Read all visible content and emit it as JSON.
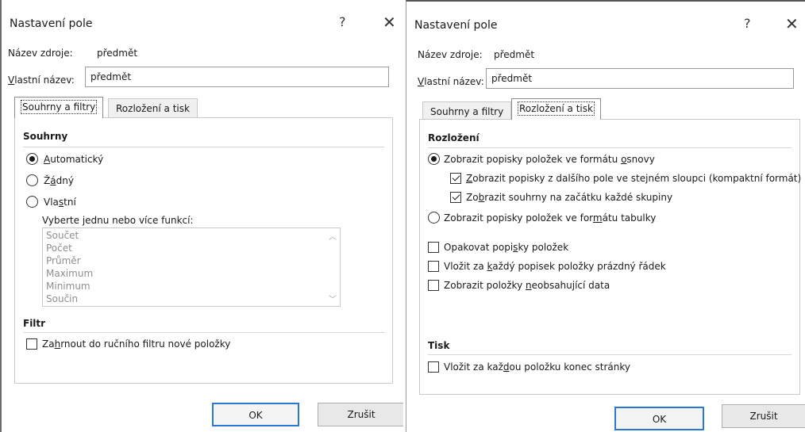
{
  "left_dialog": {
    "title": "Nastavení pole",
    "help": "?",
    "close": "✕",
    "source_name_label": "Název zdroje:",
    "source_name_value": "předmět",
    "custom_name_label": "Vlastní název:",
    "custom_name_value": "předmět",
    "tabs": [
      {
        "label": "Souhrny a filtry",
        "active": true
      },
      {
        "label": "Rozložení a tisk",
        "active": false
      }
    ],
    "summaries": {
      "heading": "Souhrny",
      "options": [
        {
          "label": "Automatický",
          "selected": true
        },
        {
          "label": "Žádný",
          "selected": false
        },
        {
          "label": "Vlastní",
          "selected": false
        }
      ],
      "functions_label": "Vyberte jednu nebo více funkcí:",
      "functions": [
        "Součet",
        "Počet",
        "Průměr",
        "Maximum",
        "Minimum",
        "Součin"
      ]
    },
    "filter": {
      "heading": "Filtr",
      "include_new_items_label": "Zahrnout do ručního filtru nové položky",
      "include_new_items_checked": false
    },
    "ok_label": "OK",
    "cancel_label": "Zrušit"
  },
  "right_dialog": {
    "title": "Nastavení pole",
    "help": "?",
    "close": "✕",
    "source_name_label": "Název zdroje:",
    "source_name_value": "předmět",
    "custom_name_label": "Vlastní název:",
    "custom_name_value": "předmět",
    "tabs": [
      {
        "label": "Souhrny a filtry",
        "active": false
      },
      {
        "label": "Rozložení a tisk",
        "active": true
      }
    ],
    "layout": {
      "heading": "Rozložení",
      "outline_form_label": "Zobrazit popisky položek ve formátu osnovy",
      "outline_form_selected": true,
      "compact_form_label": "Zobrazit popisky z dalšího pole ve stejném sloupci (kompaktní formát)",
      "compact_form_checked": true,
      "subtotals_top_label": "Zobrazit souhrny na začátku každé skupiny",
      "subtotals_top_checked": true,
      "tabular_form_label": "Zobrazit popisky položek ve formátu tabulky",
      "tabular_form_selected": false,
      "repeat_labels_label": "Opakovat popisky položek",
      "repeat_labels_checked": false,
      "blank_line_label": "Vložit za každý popisek položky prázdný řádek",
      "blank_line_checked": false,
      "show_empty_label": "Zobrazit položky neobsahující data",
      "show_empty_checked": false
    },
    "print": {
      "heading": "Tisk",
      "page_break_label": "Vložit za každou položku konec stránky",
      "page_break_checked": false
    },
    "ok_label": "OK",
    "cancel_label": "Zrušit"
  }
}
